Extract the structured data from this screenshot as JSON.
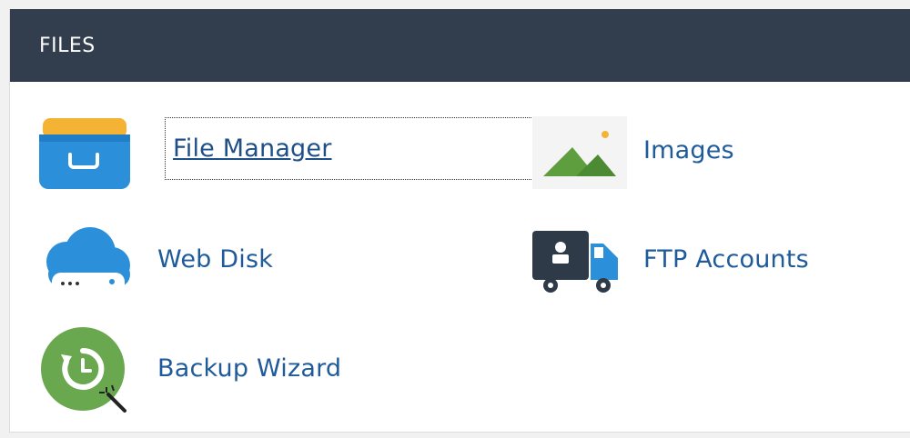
{
  "section": {
    "title": "FILES"
  },
  "apps": [
    {
      "label": "File Manager",
      "icon": "file-manager-icon",
      "focused": true
    },
    {
      "label": "Images",
      "icon": "images-icon",
      "focused": false
    },
    {
      "label": "Web Disk",
      "icon": "web-disk-icon",
      "focused": false
    },
    {
      "label": "FTP Accounts",
      "icon": "ftp-accounts-icon",
      "focused": false
    },
    {
      "label": "Backup Wizard",
      "icon": "backup-wizard-icon",
      "focused": false
    }
  ],
  "colors": {
    "header_bg": "#323e4d",
    "link": "#1f5b9a",
    "folder_blue": "#2c8fd9",
    "folder_yellow": "#f5b335",
    "images_green": "#5e9e3f",
    "backup_green": "#6aa84f"
  }
}
